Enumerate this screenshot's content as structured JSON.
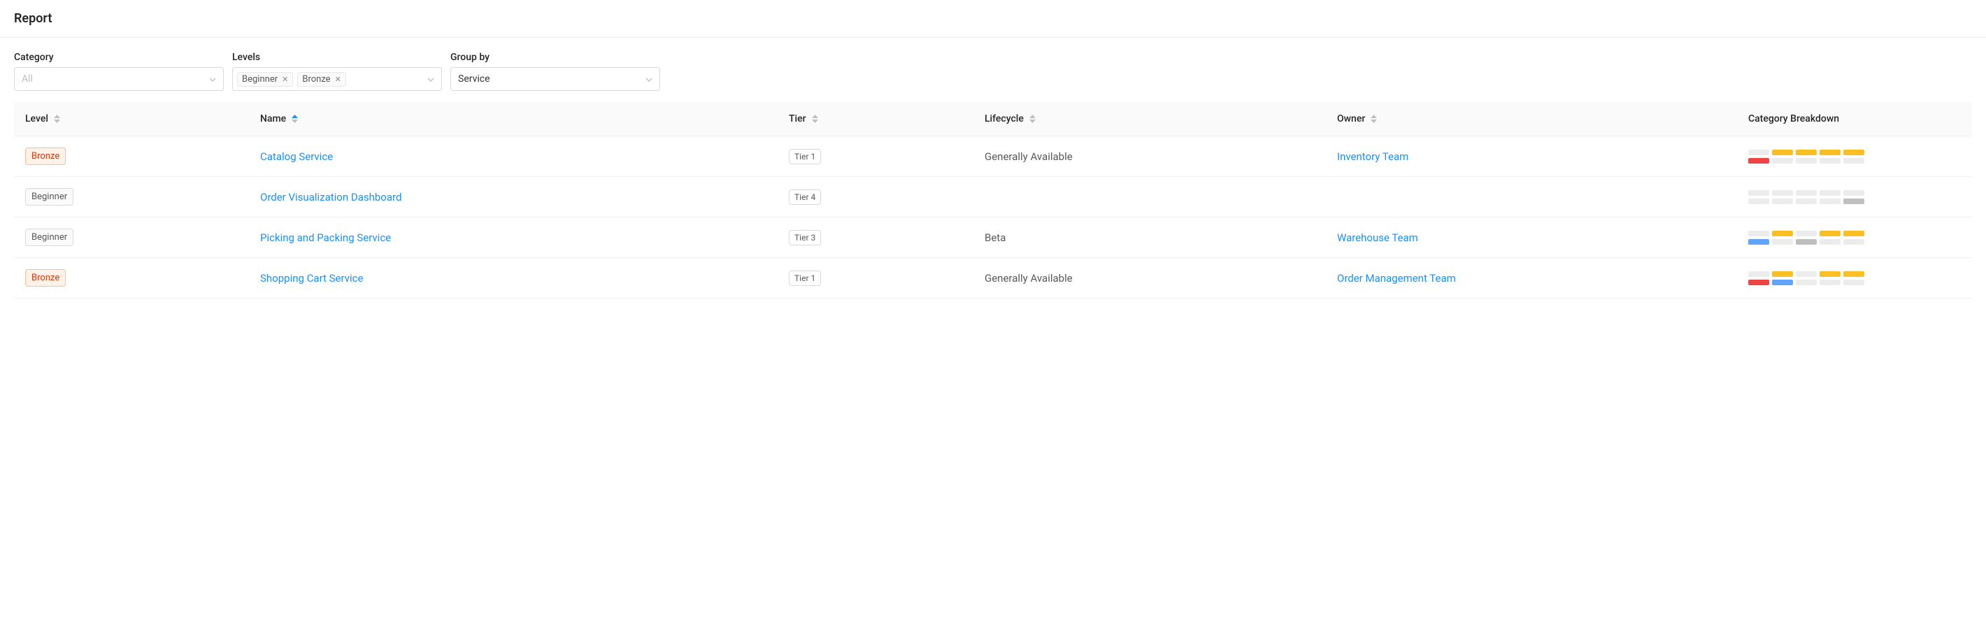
{
  "header": {
    "title": "Report"
  },
  "filters": {
    "category": {
      "label": "Category",
      "placeholder": "All"
    },
    "levels": {
      "label": "Levels",
      "tags": [
        "Beginner",
        "Bronze"
      ]
    },
    "groupby": {
      "label": "Group by",
      "value": "Service"
    }
  },
  "columns": {
    "level": {
      "label": "Level",
      "sorted": ""
    },
    "name": {
      "label": "Name",
      "sorted": "asc"
    },
    "tier": {
      "label": "Tier",
      "sorted": ""
    },
    "life": {
      "label": "Lifecycle",
      "sorted": ""
    },
    "owner": {
      "label": "Owner",
      "sorted": ""
    },
    "break": {
      "label": "Category Breakdown"
    }
  },
  "rows": [
    {
      "level": {
        "text": "Bronze",
        "variant": "bronze"
      },
      "name": "Catalog Service",
      "tier": "Tier 1",
      "lifecycle": "Generally Available",
      "owner": "Inventory Team",
      "breakdown": [
        [
          "grey",
          "yellow",
          "yellow",
          "yellow",
          "yellow"
        ],
        [
          "red",
          "grey",
          "grey",
          "grey",
          "grey"
        ]
      ]
    },
    {
      "level": {
        "text": "Beginner",
        "variant": "beginner"
      },
      "name": "Order Visualization Dashboard",
      "tier": "Tier 4",
      "lifecycle": "",
      "owner": "",
      "breakdown": [
        [
          "grey",
          "grey",
          "grey",
          "grey",
          "grey"
        ],
        [
          "grey",
          "grey",
          "grey",
          "grey",
          "grey3"
        ]
      ]
    },
    {
      "level": {
        "text": "Beginner",
        "variant": "beginner"
      },
      "name": "Picking and Packing Service",
      "tier": "Tier 3",
      "lifecycle": "Beta",
      "owner": "Warehouse Team",
      "breakdown": [
        [
          "grey",
          "yellow",
          "grey",
          "yellow",
          "yellow"
        ],
        [
          "blue",
          "grey",
          "grey3",
          "grey",
          "grey"
        ]
      ]
    },
    {
      "level": {
        "text": "Bronze",
        "variant": "bronze"
      },
      "name": "Shopping Cart Service",
      "tier": "Tier 1",
      "lifecycle": "Generally Available",
      "owner": "Order Management Team",
      "breakdown": [
        [
          "grey",
          "yellow",
          "grey",
          "yellow",
          "yellow"
        ],
        [
          "red",
          "blue",
          "grey",
          "grey",
          "grey"
        ]
      ]
    }
  ]
}
